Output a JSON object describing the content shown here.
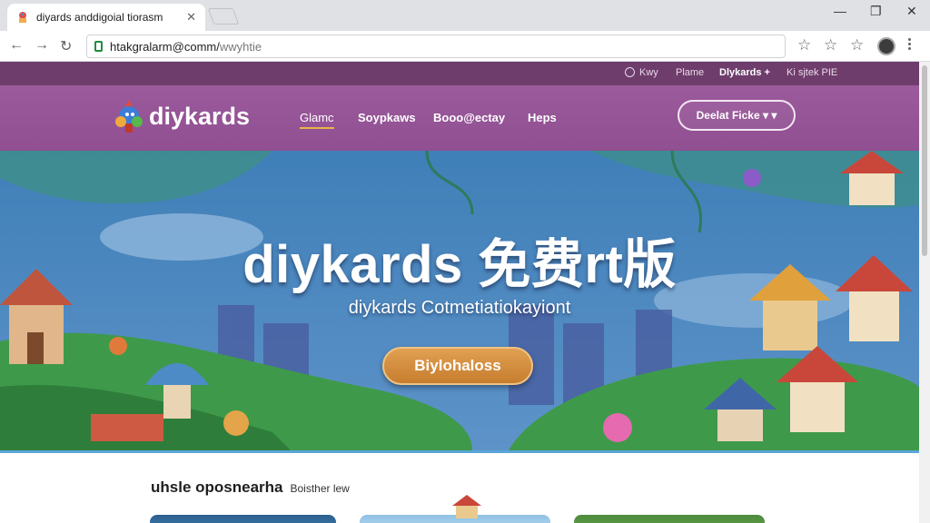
{
  "browser": {
    "tab_title": "diyards anddigoial tiorasm",
    "url_main": "htakgralarm@comm/",
    "url_path": "wwyhtie",
    "window_controls": [
      "minimize-icon",
      "restore-icon",
      "close-icon"
    ]
  },
  "utilbar": {
    "items": [
      "Kwy",
      "Plame",
      "Dlykards",
      "Ki sjtek PIE"
    ]
  },
  "header": {
    "logo_text": "diykards",
    "nav": [
      "Glamc",
      "Soypkaws",
      "Booo@ectay",
      "Heps"
    ],
    "cta_label": "Deelat Ficke"
  },
  "hero": {
    "title": "diykards 免费rt版",
    "subtitle": "diykards Cotmetiatiokayiont",
    "button_label": "Biylohaloss"
  },
  "section": {
    "title": "uhsle oposnearha",
    "tag": "Boisther lew"
  },
  "colors": {
    "utilbar": "#6e3d6c",
    "nav": "#9b5a9c",
    "accent": "#e7b649",
    "hero_button": "#d28a3c",
    "divider": "#5ba6d8"
  }
}
